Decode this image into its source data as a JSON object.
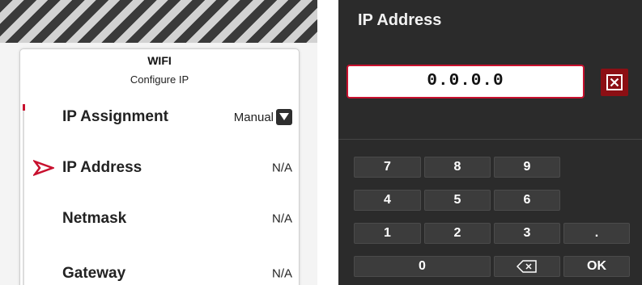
{
  "wifi_panel": {
    "title": "WIFI",
    "subtitle": "Configure IP",
    "rows": [
      {
        "label": "IP Assignment",
        "value": "Manual"
      },
      {
        "label": "IP Address",
        "value": "N/A"
      },
      {
        "label": "Netmask",
        "value": "N/A"
      },
      {
        "label": "Gateway",
        "value": "N/A"
      }
    ],
    "selected_row": "IP Address"
  },
  "ip_dialog": {
    "title": "IP Address",
    "input_value": "0.0.0.0",
    "keypad": {
      "row1": [
        "7",
        "8",
        "9"
      ],
      "row2": [
        "4",
        "5",
        "6"
      ],
      "row3": [
        "1",
        "2",
        "3",
        "."
      ],
      "row4": [
        "0",
        "OK"
      ]
    }
  },
  "icons": {
    "select_arrow": "chevron-down-icon",
    "clear": "clear-x-icon",
    "backspace": "backspace-icon",
    "selection_pointer": "pointer-arrow-icon"
  },
  "colors": {
    "accent_red": "#c8102e",
    "clear_button_red": "#8c0f14",
    "dialog_background": "#2b2b2b",
    "key_background": "#3c3c3c"
  }
}
